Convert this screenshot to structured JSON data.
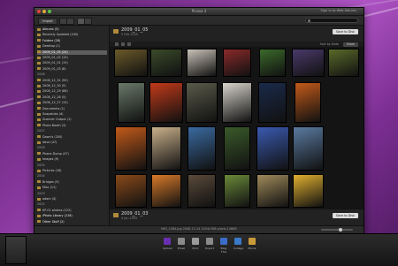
{
  "window": {
    "title": "Picasa 3",
    "sign_in": "Sign in to Web Albums"
  },
  "toolbar": {
    "import_label": "Import",
    "search_placeholder": ""
  },
  "sidebar": {
    "items": [
      {
        "label": "Albums (5)",
        "kind": "hdr"
      },
      {
        "label": "Recently Updated (245)",
        "kind": "item"
      },
      {
        "label": "Folders (26)",
        "kind": "hdr"
      },
      {
        "label": "Desktop (1)",
        "kind": "item"
      },
      {
        "label": "2009_01_05 (24)",
        "kind": "sel"
      },
      {
        "label": "2009_01_02 (10)",
        "kind": "item"
      },
      {
        "label": "2009_01_01 (15)",
        "kind": "item"
      },
      {
        "label": "2009_01_03 (8)",
        "kind": "item"
      },
      {
        "label": "2008",
        "kind": "group"
      },
      {
        "label": "2008_12_31 (90)",
        "kind": "item"
      },
      {
        "label": "2008_12_30 (5)",
        "kind": "item"
      },
      {
        "label": "2008_12_29 (86)",
        "kind": "item"
      },
      {
        "label": "2008_12_28 (5)",
        "kind": "item"
      },
      {
        "label": "2008_12_27 (15)",
        "kind": "item"
      },
      {
        "label": "Documents (1)",
        "kind": "item"
      },
      {
        "label": "Snapshots (4)",
        "kind": "item"
      },
      {
        "label": "Scanner Output (1)",
        "kind": "item"
      },
      {
        "label": "Photo Booth (3)",
        "kind": "item"
      },
      {
        "label": "2007",
        "kind": "group"
      },
      {
        "label": "Dawn's (200)",
        "kind": "item"
      },
      {
        "label": "dave (47)",
        "kind": "item"
      },
      {
        "label": "2006",
        "kind": "group"
      },
      {
        "label": "Phone Dump (47)",
        "kind": "item"
      },
      {
        "label": "Images (9)",
        "kind": "item"
      },
      {
        "label": "2005",
        "kind": "group"
      },
      {
        "label": "Pictures (18)",
        "kind": "item"
      },
      {
        "label": "2004",
        "kind": "group"
      },
      {
        "label": "Bridges (9)",
        "kind": "item"
      },
      {
        "label": "Misc (11)",
        "kind": "item"
      },
      {
        "label": "2003",
        "kind": "group"
      },
      {
        "label": "adam (4)",
        "kind": "item"
      },
      {
        "label": "2002",
        "kind": "group"
      },
      {
        "label": "KP-01 photos (122)",
        "kind": "item"
      },
      {
        "label": "iPhoto Library (216)",
        "kind": "hdr"
      },
      {
        "label": "Other Stuff (2)",
        "kind": "hdr"
      }
    ]
  },
  "main": {
    "folder1": {
      "name": "2009_01_05",
      "date": "5 Feb 2009",
      "save_label": "Save to Disk"
    },
    "sort_label": "Sort by Date",
    "share_label": "Share",
    "folder2": {
      "name": "2009_01_03",
      "date": "4 Jan 2009",
      "save_label": "Save to Disk"
    }
  },
  "status": {
    "text": "IMG_1084.jpg  2008-12-14  1024x768 pixels  148KB"
  },
  "tray": {
    "items": [
      {
        "label": "Upload",
        "color": "#6a2fb0"
      },
      {
        "label": "Email",
        "color": "#8a8a8a"
      },
      {
        "label": "Print",
        "color": "#9a9a9a"
      },
      {
        "label": "Export",
        "color": "#8a8a8a"
      },
      {
        "label": "Blog This",
        "color": "#3a6cc8"
      },
      {
        "label": "Collage",
        "color": "#3a7ac8"
      },
      {
        "label": "Movie",
        "color": "#c89a3a"
      }
    ]
  },
  "thumbs_row1": [
    "#6b5a2a",
    "#3a4a2a",
    "#c9c2b8",
    "#8a2a2a",
    "#3b6a2b",
    "#4a3a6a",
    "#5a6a2a"
  ],
  "thumbs_row2": [
    "#6a7a6a",
    "#c23a1a",
    "#5a5a4a",
    "#d8d4cc",
    "#1a2a4a",
    "#c25a1a"
  ],
  "thumbs_row3": [
    "#c25a1a",
    "#c9b08a",
    "#3a6aa0",
    "#3a5a2a",
    "#3a5ab0",
    "#5a7aa0"
  ],
  "thumbs_row4": [
    "#8a4a1a",
    "#d87a2a",
    "#5a4a3a",
    "#6a8a3a",
    "#a08a5a",
    "#e0b030"
  ]
}
